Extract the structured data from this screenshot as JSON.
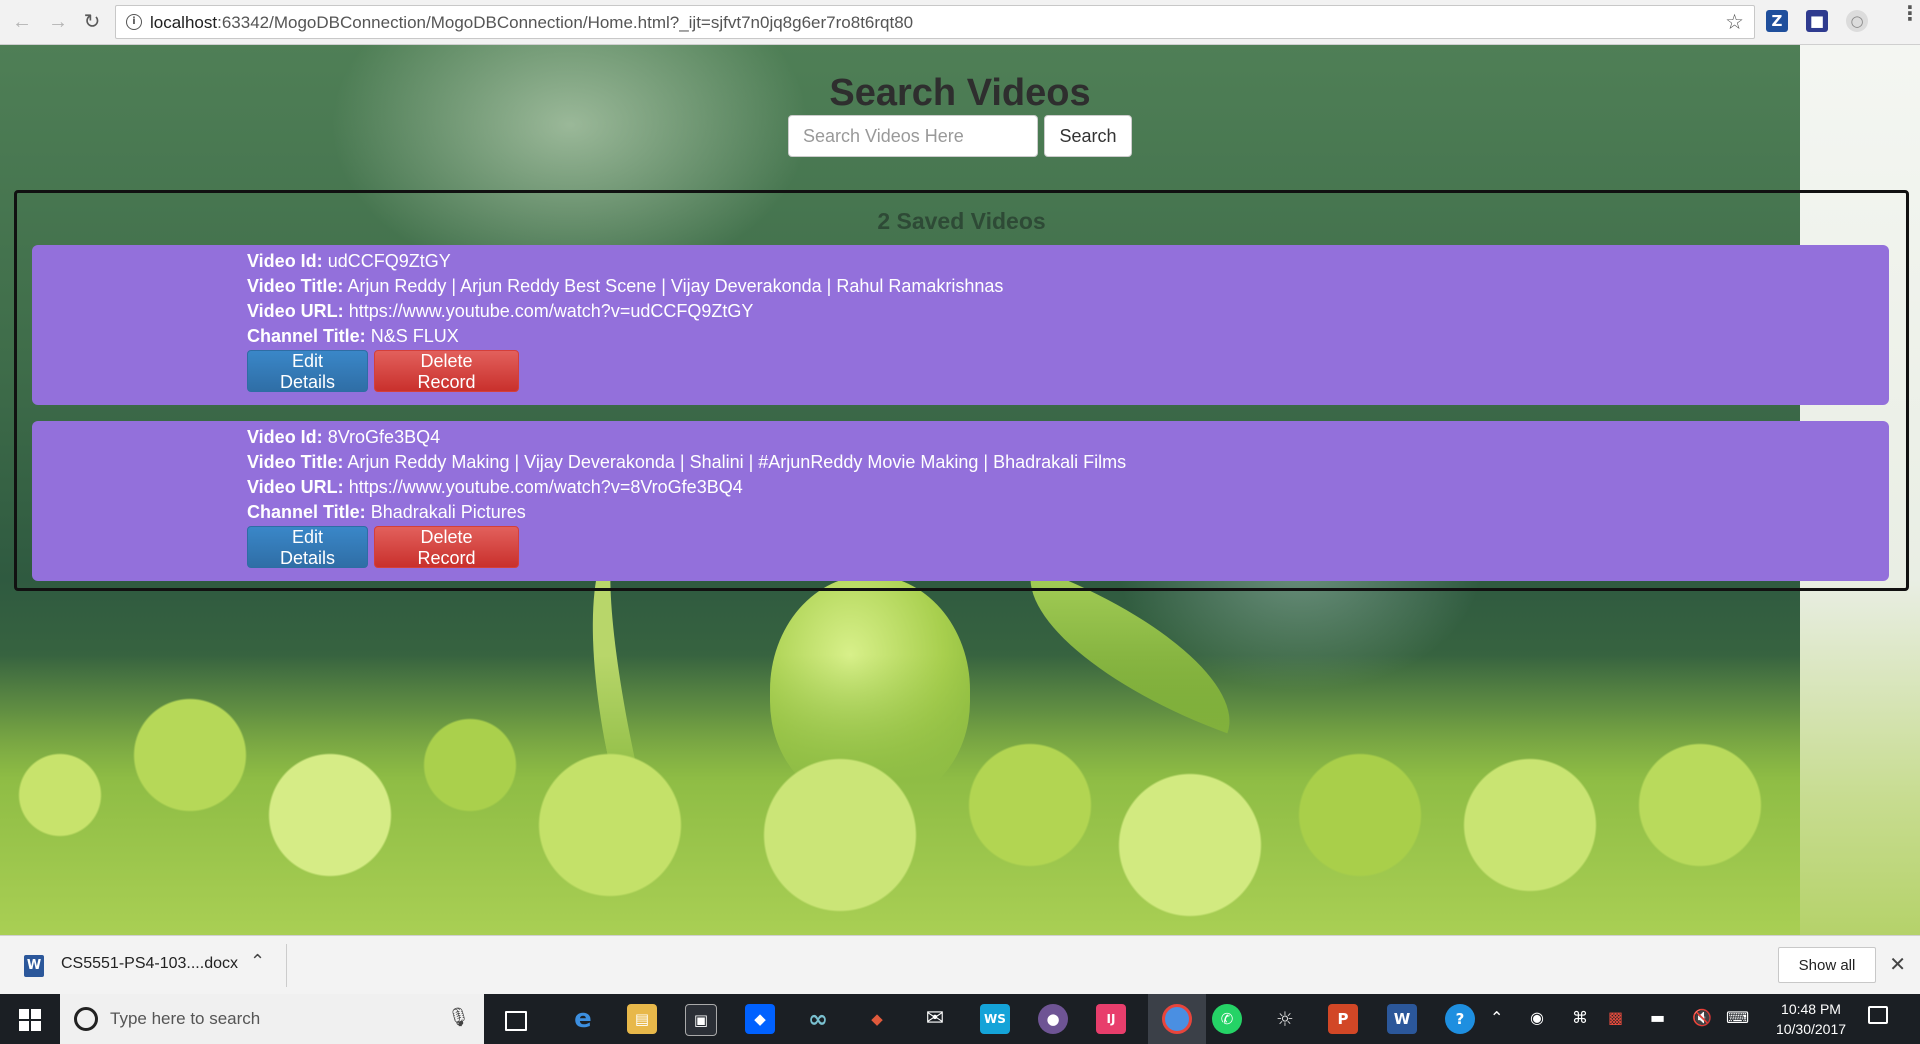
{
  "browser": {
    "url_host": "localhost",
    "url_rest": ":63342/MogoDBConnection/MogoDBConnection/Home.html?_ijt=sjfvt7n0jq8g6er7ro8t6rqt80",
    "icons": [
      "back-icon",
      "forward-icon",
      "reload-icon",
      "info-icon",
      "star-icon",
      "menu-icon"
    ]
  },
  "page": {
    "title": "Search Videos",
    "search": {
      "placeholder": "Search Videos Here",
      "value": "",
      "button_label": "Search"
    },
    "results": {
      "heading": "2 Saved Videos",
      "videos": [
        {
          "id_label": "Video Id:",
          "id": "udCCFQ9ZtGY",
          "title_label": "Video Title:",
          "title": "Arjun Reddy | Arjun Reddy Best Scene | Vijay Deverakonda | Rahul Ramakrishnas",
          "url_label": "Video URL:",
          "url": "https://www.youtube.com/watch?v=udCCFQ9ZtGY",
          "channel_label": "Channel Title:",
          "channel": "N&S FLUX",
          "edit_label": "Edit Details",
          "delete_label": "Delete Record"
        },
        {
          "id_label": "Video Id:",
          "id": "8VroGfe3BQ4",
          "title_label": "Video Title:",
          "title": "Arjun Reddy Making | Vijay Deverakonda | Shalini | #ArjunReddy Movie Making | Bhadrakali Films",
          "url_label": "Video URL:",
          "url": "https://www.youtube.com/watch?v=8VroGfe3BQ4",
          "channel_label": "Channel Title:",
          "channel": "Bhadrakali Pictures",
          "edit_label": "Edit Details",
          "delete_label": "Delete Record"
        }
      ]
    },
    "colors": {
      "card": "#9370db",
      "edit": "#337ab7",
      "delete": "#d9534f"
    }
  },
  "download_shelf": {
    "file_name": "CS5551-PS4-103....docx",
    "show_all": "Show all"
  },
  "taskbar": {
    "search_placeholder": "Type here to search",
    "time": "10:48 PM",
    "date": "10/30/2017"
  }
}
